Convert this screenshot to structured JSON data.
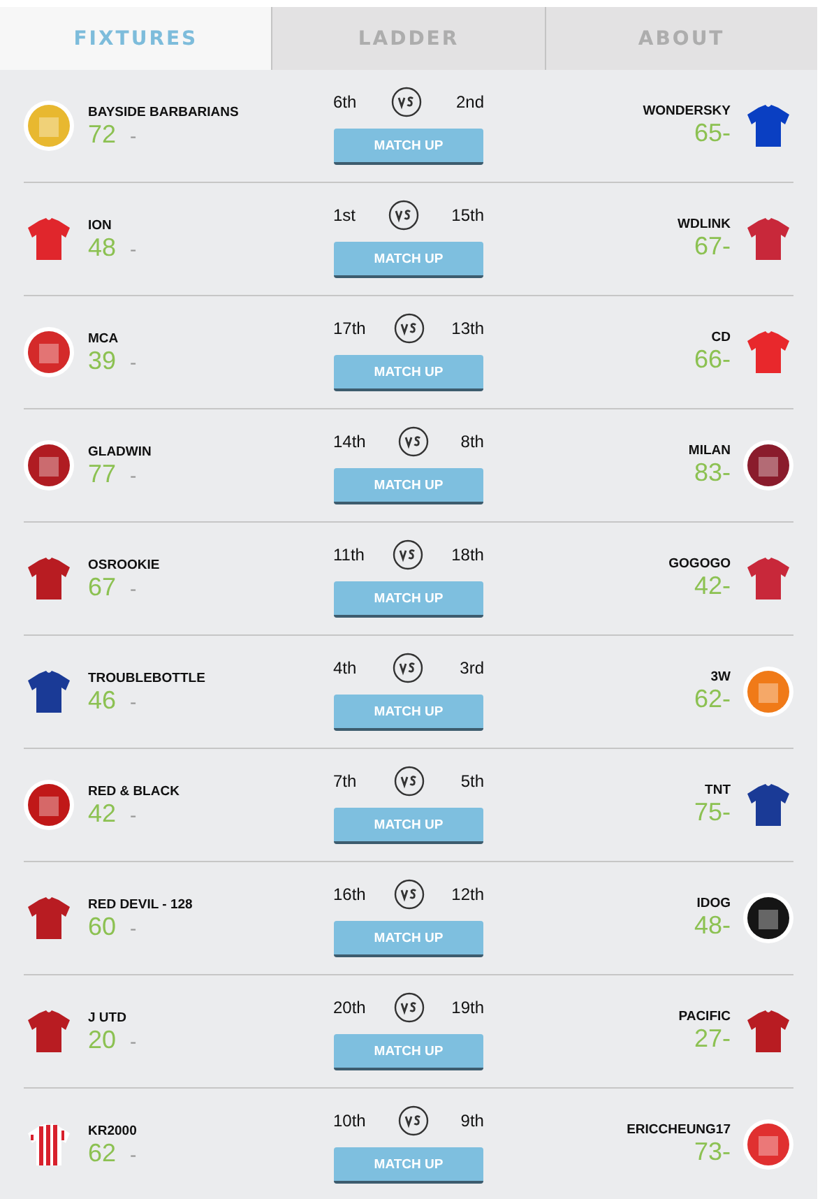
{
  "tabs": [
    {
      "label": "FIXTURES",
      "selected": true
    },
    {
      "label": "LADDER",
      "selected": false
    },
    {
      "label": "ABOUT",
      "selected": false
    }
  ],
  "fixtures": [
    {
      "home": {
        "name": "BAYSIDE BARBARIANS",
        "score": "72",
        "projection": "-",
        "rank": "6th",
        "crest": {
          "kind": "badge",
          "color": "#e8b830"
        }
      },
      "away": {
        "name": "WONDERSKY",
        "score": "65",
        "projection": "-",
        "rank": "2nd",
        "crest": {
          "kind": "shirt",
          "color": "#0a3fc2"
        }
      },
      "button": "MATCH UP"
    },
    {
      "home": {
        "name": "ION",
        "score": "48",
        "projection": "-",
        "rank": "1st",
        "crest": {
          "kind": "shirt",
          "color": "#e0262c"
        }
      },
      "away": {
        "name": "WDLINK",
        "score": "67",
        "projection": "-",
        "rank": "15th",
        "crest": {
          "kind": "shirt",
          "color": "#c8283a"
        }
      },
      "button": "MATCH UP"
    },
    {
      "home": {
        "name": "MCA",
        "score": "39",
        "projection": "-",
        "rank": "17th",
        "crest": {
          "kind": "badge",
          "color": "#d42a2a"
        }
      },
      "away": {
        "name": "CD",
        "score": "66",
        "projection": "-",
        "rank": "13th",
        "crest": {
          "kind": "shirt",
          "color": "#e8282c"
        }
      },
      "button": "MATCH UP"
    },
    {
      "home": {
        "name": "GLADWIN",
        "score": "77",
        "projection": "-",
        "rank": "14th",
        "crest": {
          "kind": "badge",
          "color": "#b01c22"
        }
      },
      "away": {
        "name": "MILAN",
        "score": "83",
        "projection": "-",
        "rank": "8th",
        "crest": {
          "kind": "badge",
          "color": "#8a1c2c"
        }
      },
      "button": "MATCH UP"
    },
    {
      "home": {
        "name": "OSROOKIE",
        "score": "67",
        "projection": "-",
        "rank": "11th",
        "crest": {
          "kind": "shirt",
          "color": "#b81c22"
        }
      },
      "away": {
        "name": "GOGOGO",
        "score": "42",
        "projection": "-",
        "rank": "18th",
        "crest": {
          "kind": "shirt",
          "color": "#c8283a"
        }
      },
      "button": "MATCH UP"
    },
    {
      "home": {
        "name": "TROUBLEBOTTLE",
        "score": "46",
        "projection": "-",
        "rank": "4th",
        "crest": {
          "kind": "shirt",
          "color": "#1a3a96"
        }
      },
      "away": {
        "name": "3W",
        "score": "62",
        "projection": "-",
        "rank": "3rd",
        "crest": {
          "kind": "badge",
          "color": "#f07a18"
        }
      },
      "button": "MATCH UP"
    },
    {
      "home": {
        "name": "RED & BLACK",
        "score": "42",
        "projection": "-",
        "rank": "7th",
        "crest": {
          "kind": "badge",
          "color": "#c01818"
        }
      },
      "away": {
        "name": "TNT",
        "score": "75",
        "projection": "-",
        "rank": "5th",
        "crest": {
          "kind": "shirt",
          "color": "#1a3a96"
        }
      },
      "button": "MATCH UP"
    },
    {
      "home": {
        "name": "RED DEVIL - 128",
        "score": "60",
        "projection": "-",
        "rank": "16th",
        "crest": {
          "kind": "shirt",
          "color": "#b81c22"
        }
      },
      "away": {
        "name": "IDOG",
        "score": "48",
        "projection": "-",
        "rank": "12th",
        "crest": {
          "kind": "badge",
          "color": "#151515"
        }
      },
      "button": "MATCH UP"
    },
    {
      "home": {
        "name": "J UTD",
        "score": "20",
        "projection": "-",
        "rank": "20th",
        "crest": {
          "kind": "shirt",
          "color": "#b81c22"
        }
      },
      "away": {
        "name": "PACIFIC",
        "score": "27",
        "projection": "-",
        "rank": "19th",
        "crest": {
          "kind": "shirt",
          "color": "#b81c22"
        }
      },
      "button": "MATCH UP"
    },
    {
      "home": {
        "name": "KR2000",
        "score": "62",
        "projection": "-",
        "rank": "10th",
        "crest": {
          "kind": "striped-shirt",
          "color": "#d8202c"
        }
      },
      "away": {
        "name": "ERICCHEUNG17",
        "score": "73",
        "projection": "-",
        "rank": "9th",
        "crest": {
          "kind": "badge",
          "color": "#e03030"
        }
      },
      "button": "MATCH UP"
    }
  ]
}
